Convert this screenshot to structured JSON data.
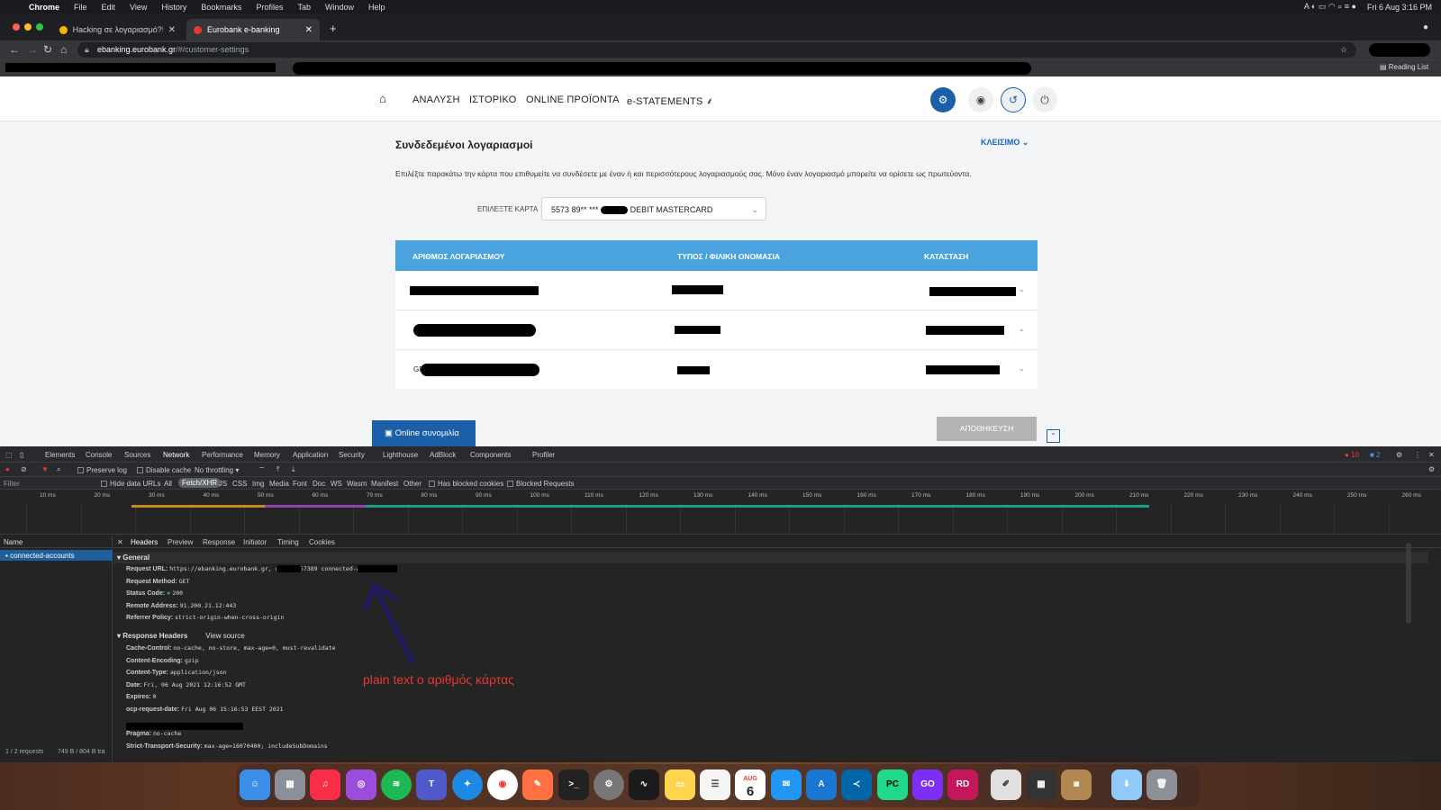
{
  "menubar": {
    "app": "Chrome",
    "items": [
      "File",
      "Edit",
      "View",
      "History",
      "Bookmarks",
      "Profiles",
      "Tab",
      "Window",
      "Help"
    ],
    "clock": "Fri 6 Aug  3:16 PM"
  },
  "browser": {
    "tabs": [
      {
        "title": "Hacking σε λογαριασμό?!? - Σ…",
        "active": false
      },
      {
        "title": "Eurobank e-banking",
        "active": true
      }
    ],
    "new_tab": "+",
    "url_host": "ebanking.eurobank.gr",
    "url_path": "/#/customer-settings",
    "reading_list": "Reading List"
  },
  "site": {
    "nav": [
      "ΑΝΑΛΥΣΗ",
      "ΙΣΤΟΡΙΚΟ",
      "ONLINE ΠΡΟΪΟΝΤΑ",
      "e-STATEMENTS"
    ],
    "panel_title": "Συνδεδεμένοι λογαριασμοί",
    "collapse_label": "ΚΛΕΙΣΙΜΟ",
    "instructions": "Επιλέξτε παρακάτω την κάρτα που επιθυμείτε να συνδέσετε με έναν ή και περισσότερους λογαριασμούς σας. Μόνο έναν λογαριασμό μπορείτε να ορίσετε ως πρωτεύοντα.",
    "card_label": "ΕΠΙΛΕΞΤΕ ΚΑΡΤΑ",
    "card_value_prefix": "5573 89** ***",
    "card_value_suffix": "DEBIT MASTERCARD",
    "table_headers": [
      "ΑΡΙΘΜΟΣ ΛΟΓΑΡΙΑΣΜΟΥ",
      "ΤΥΠΟΣ / ΦΙΛΙΚΗ ΟΝΟΜΑΣΙΑ",
      "ΚΑΤΑΣΤΑΣΗ"
    ],
    "row_prefixes": [
      "",
      "G",
      "GR"
    ],
    "chat_label": "Online συνομιλία",
    "save_label": "ΑΠΟΘΗΚΕΥΣΗ"
  },
  "devtools": {
    "tabs": [
      "Elements",
      "Console",
      "Sources",
      "Network",
      "Performance",
      "Memory",
      "Application",
      "Security",
      "Lighthouse",
      "AdBlock",
      "Components",
      "Profiler"
    ],
    "active_tab": "Network",
    "errors": "10",
    "messages": "2",
    "preserve_log": "Preserve log",
    "disable_cache": "Disable cache",
    "throttling": "No throttling",
    "filter_placeholder": "Filter",
    "filter_types": [
      "Hide data URLs",
      "All",
      "Fetch/XHR",
      "JS",
      "CSS",
      "Img",
      "Media",
      "Font",
      "Doc",
      "WS",
      "Wasm",
      "Manifest",
      "Other",
      "Has blocked cookies",
      "Blocked Requests"
    ],
    "timeline_ticks": [
      "10 ms",
      "20 ms",
      "30 ms",
      "40 ms",
      "50 ms",
      "60 ms",
      "70 ms",
      "80 ms",
      "90 ms",
      "100 ms",
      "110 ms",
      "120 ms",
      "130 ms",
      "140 ms",
      "150 ms",
      "160 ms",
      "170 ms",
      "180 ms",
      "190 ms",
      "200 ms",
      "210 ms",
      "220 ms",
      "230 ms",
      "240 ms",
      "250 ms",
      "260 ms"
    ],
    "name_header": "Name",
    "request_name": "connected-accounts",
    "requests_count": "1 / 2 requests",
    "transfer": "749 B / 804 B tra",
    "detail_tabs": [
      "Headers",
      "Preview",
      "Response",
      "Initiator",
      "Timing",
      "Cookies"
    ],
    "general_title": "General",
    "general": [
      {
        "k": "Request URL:",
        "v": "https://ebanking.eurobank.gr,         cards/557389            connected-accounts"
      },
      {
        "k": "Request Method:",
        "v": "GET"
      },
      {
        "k": "Status Code:",
        "v": "200"
      },
      {
        "k": "Remote Address:",
        "v": "91.200.21.12:443"
      },
      {
        "k": "Referrer Policy:",
        "v": "strict-origin-when-cross-origin"
      }
    ],
    "response_title": "Response Headers",
    "view_source": "View source",
    "response": [
      {
        "k": "Cache-Control:",
        "v": "no-cache, no-store, max-age=0, must-revalidate"
      },
      {
        "k": "Content-Encoding:",
        "v": "gzip"
      },
      {
        "k": "Content-Type:",
        "v": "application/json"
      },
      {
        "k": "Date:",
        "v": "Fri, 06 Aug 2021 12:16:52 GMT"
      },
      {
        "k": "Expires:",
        "v": "0"
      },
      {
        "k": "ocp-request-date:",
        "v": "Fri Aug 06 15:16:53 EEST 2021"
      },
      {
        "k": "",
        "v": ""
      },
      {
        "k": "Pragma:",
        "v": "no-cache"
      },
      {
        "k": "Strict-Transport-Security:",
        "v": "max-age=16070400; includeSubDomains"
      }
    ]
  },
  "annotation": "plain text  ο αριθμός κάρτας",
  "dock": {
    "calendar_month": "AUG",
    "calendar_day": "6"
  }
}
